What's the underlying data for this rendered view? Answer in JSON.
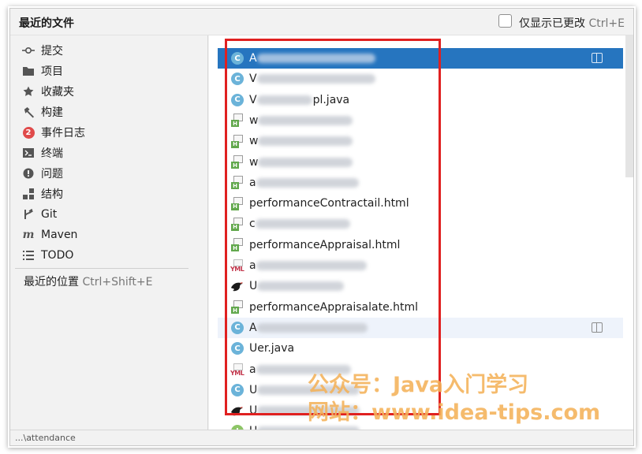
{
  "dialog": {
    "title": "最近的文件",
    "filter_label": "仅显示已更改",
    "filter_shortcut": "Ctrl+E",
    "status_path": "...\\attendance"
  },
  "nav": {
    "items": [
      {
        "label": "提交",
        "icon": "commit-icon"
      },
      {
        "label": "项目",
        "icon": "folder-icon"
      },
      {
        "label": "收藏夹",
        "icon": "star-icon"
      },
      {
        "label": "构建",
        "icon": "hammer-icon"
      },
      {
        "label": "事件日志",
        "icon": "event-log-badge",
        "badge": "2"
      },
      {
        "label": "终端",
        "icon": "terminal-icon"
      },
      {
        "label": "问题",
        "icon": "problems-icon"
      },
      {
        "label": "结构",
        "icon": "structure-icon"
      },
      {
        "label": "Git",
        "icon": "git-icon"
      },
      {
        "label": "Maven",
        "icon": "maven-icon"
      },
      {
        "label": "TODO",
        "icon": "todo-icon"
      }
    ],
    "recent_locations": "最近的位置",
    "recent_locations_shortcut": "Ctrl+Shift+E"
  },
  "files": [
    {
      "type": "class",
      "visible_prefix": "A",
      "visible_suffix": "",
      "selected": true
    },
    {
      "type": "class",
      "visible_prefix": "V",
      "visible_suffix": ""
    },
    {
      "type": "class",
      "visible_prefix": "V",
      "visible_suffix": "pl.java"
    },
    {
      "type": "html",
      "visible_prefix": "w",
      "visible_suffix": ""
    },
    {
      "type": "html",
      "visible_prefix": "w",
      "visible_suffix": ""
    },
    {
      "type": "html",
      "visible_prefix": "w",
      "visible_suffix": ""
    },
    {
      "type": "html",
      "visible_prefix": "a",
      "visible_suffix": ""
    },
    {
      "type": "html",
      "visible_prefix": "performanceContract",
      "visible_suffix": "ail.html"
    },
    {
      "type": "html",
      "visible_prefix": "c",
      "visible_suffix": ""
    },
    {
      "type": "html",
      "visible_prefix": "performanceAppraisal",
      "visible_suffix": ".html"
    },
    {
      "type": "yml",
      "visible_prefix": "a",
      "visible_suffix": ""
    },
    {
      "type": "mybatis",
      "visible_prefix": "U",
      "visible_suffix": ""
    },
    {
      "type": "html",
      "visible_prefix": "performanceAppraisal",
      "visible_suffix": "ate.html"
    },
    {
      "type": "class",
      "visible_prefix": "A",
      "visible_suffix": "",
      "highlighted": true
    },
    {
      "type": "class",
      "visible_prefix": "U",
      "visible_suffix": "er.java"
    },
    {
      "type": "yml",
      "visible_prefix": "a",
      "visible_suffix": ""
    },
    {
      "type": "class",
      "visible_prefix": "U",
      "visible_suffix": ""
    },
    {
      "type": "mybatis",
      "visible_prefix": "U",
      "visible_suffix": ""
    },
    {
      "type": "interface",
      "visible_prefix": "U",
      "visible_suffix": ""
    }
  ],
  "watermark": {
    "line1": "公众号：Java入门学习",
    "line2": "网站：www.idea-tips.com"
  },
  "colors": {
    "selection": "#2675bf",
    "highlight": "#eef3fb",
    "annotation": "#e02020",
    "watermark": "#f4b25a"
  }
}
